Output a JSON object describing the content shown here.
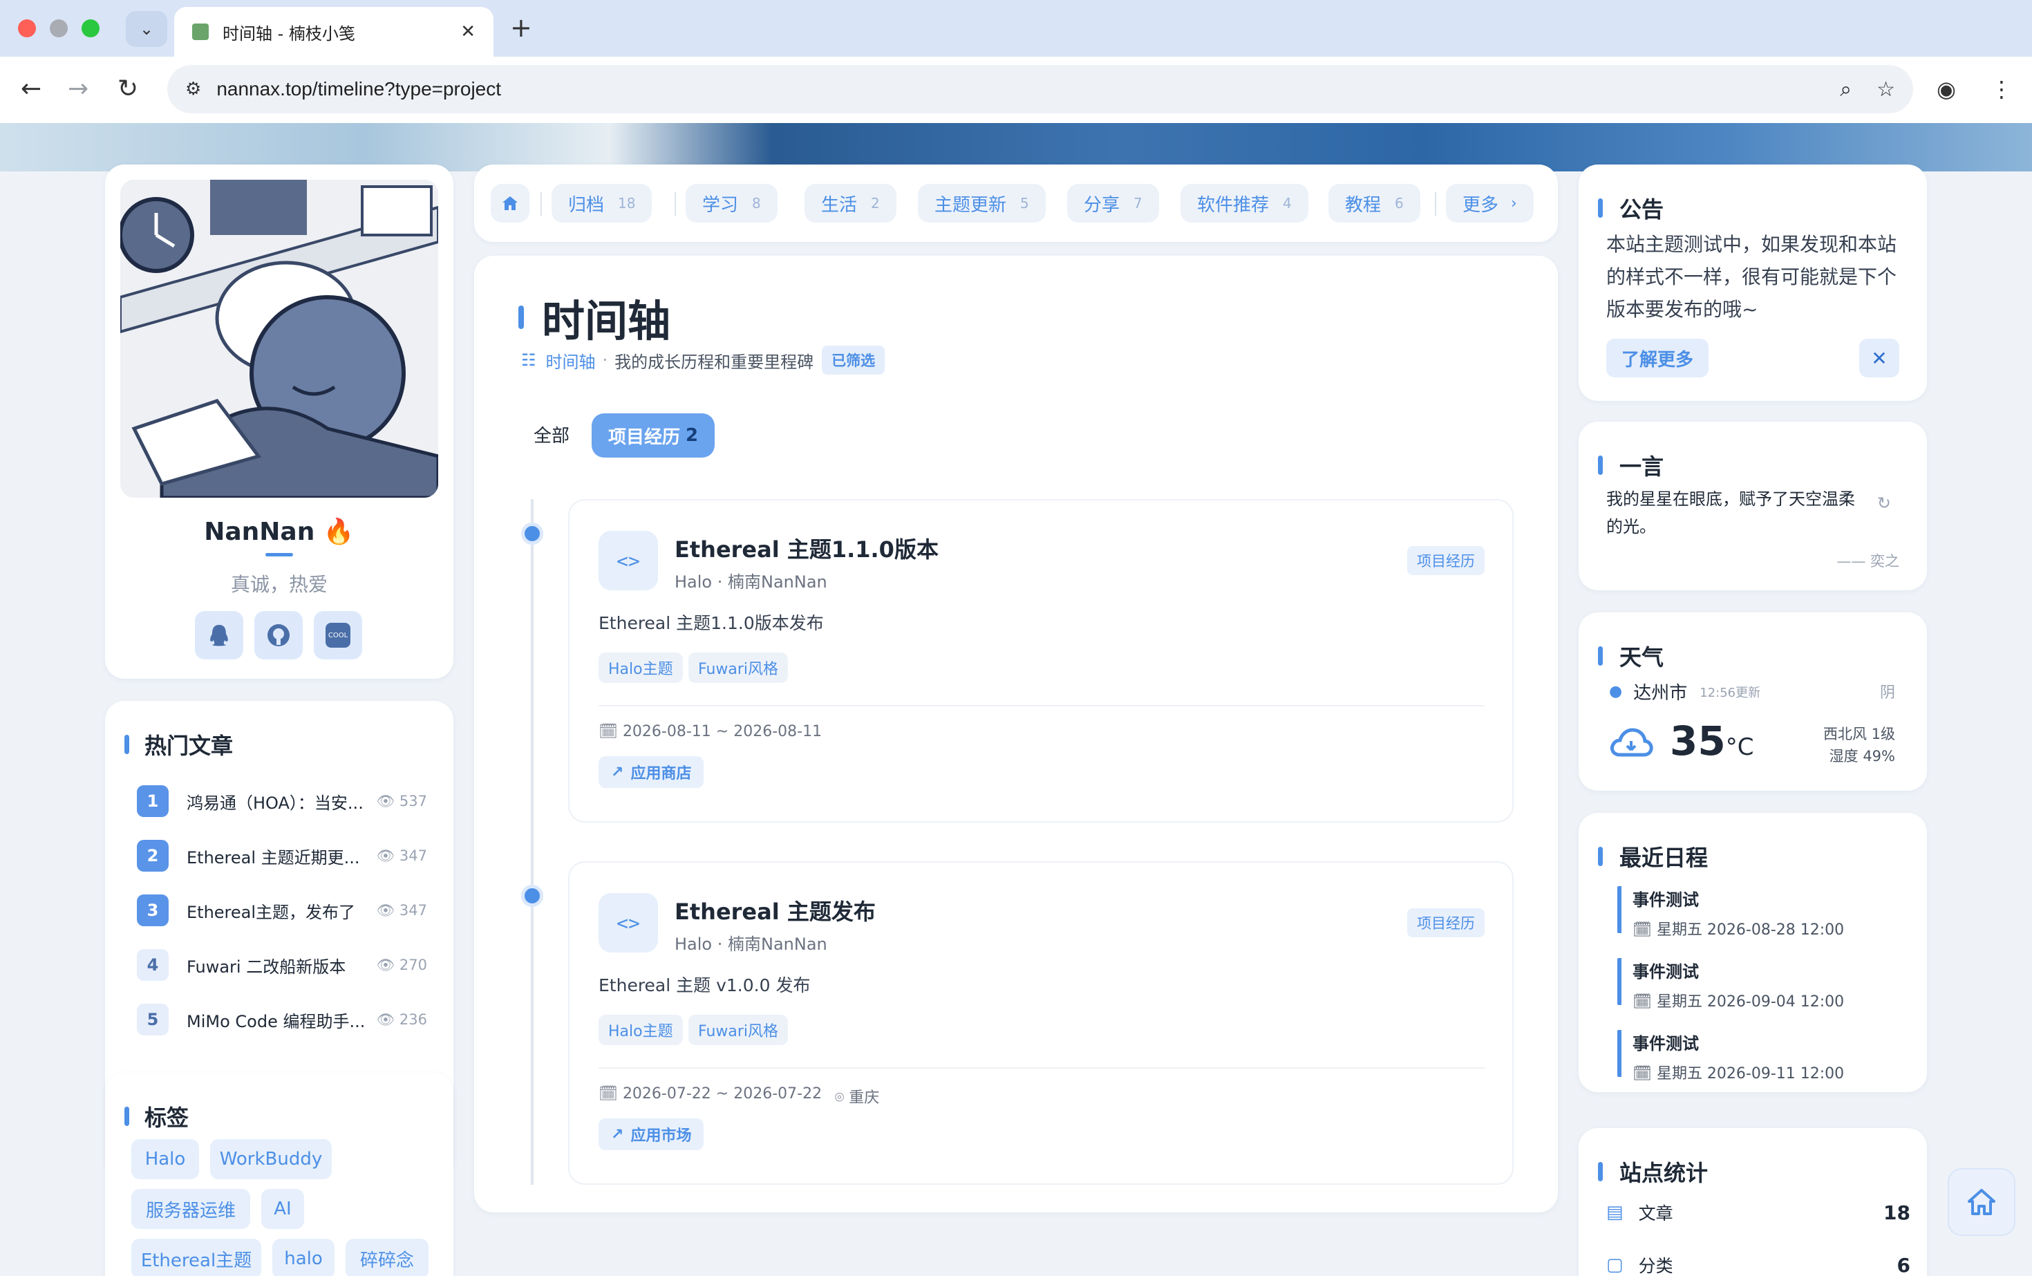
{
  "browser": {
    "tab_title": "时间轴 - 楠枝小笺",
    "url": "nannax.top/timeline?type=project",
    "tab_dropdown_icon": "chevron-down-icon",
    "new_tab_icon": "plus-icon"
  },
  "profile": {
    "name": "NanNan",
    "motto": "真诚，热爱",
    "social": [
      "qq-icon",
      "github-icon",
      "coolapk-icon"
    ],
    "social_cool_label": "COOL"
  },
  "hot": {
    "title": "热门文章",
    "items": [
      {
        "rank": "1",
        "title": "鸿易通（HOA）：当安...",
        "views": "537"
      },
      {
        "rank": "2",
        "title": "Ethereal 主题近期更...",
        "views": "347"
      },
      {
        "rank": "3",
        "title": "Ethereal主题，发布了",
        "views": "347"
      },
      {
        "rank": "4",
        "title": "Fuwari 二改船新版本",
        "views": "270"
      },
      {
        "rank": "5",
        "title": "MiMo Code 编程助手...",
        "views": "236"
      }
    ]
  },
  "tags": {
    "title": "标签",
    "items": [
      "Halo",
      "WorkBuddy",
      "服务器运维",
      "AI",
      "Ethereal主题",
      "halo",
      "碎碎念"
    ]
  },
  "nav": {
    "items": [
      {
        "label": "归档",
        "count": "18"
      },
      {
        "label": "学习",
        "count": "8"
      },
      {
        "label": "生活",
        "count": "2"
      },
      {
        "label": "主题更新",
        "count": "5"
      },
      {
        "label": "分享",
        "count": "7"
      },
      {
        "label": "软件推荐",
        "count": "4"
      },
      {
        "label": "教程",
        "count": "6"
      }
    ],
    "more": "更多",
    "more_icon": "chevron-right-icon",
    "home_icon": "home-icon"
  },
  "timeline": {
    "title": "时间轴",
    "crumb_link": "时间轴",
    "crumb_sep": "·",
    "crumb_desc": "我的成长历程和重要里程碑",
    "filtered_badge": "已筛选",
    "filter_all": "全部",
    "filter_active": "项目经历",
    "filter_active_count": "2",
    "entries": [
      {
        "title": "Ethereal 主题1.1.0版本",
        "subtitle": "Halo · 楠南NanNan",
        "category": "项目经历",
        "desc": "Ethereal 主题1.1.0版本发布",
        "tags": [
          "Halo主题",
          "Fuwari风格"
        ],
        "date": "2026-08-11 ~ 2026-08-11",
        "location": "",
        "link": "应用商店"
      },
      {
        "title": "Ethereal 主题发布",
        "subtitle": "Halo · 楠南NanNan",
        "category": "项目经历",
        "desc": "Ethereal 主题 v1.0.0 发布",
        "tags": [
          "Halo主题",
          "Fuwari风格"
        ],
        "date": "2026-07-22 ~ 2026-07-22",
        "location": "重庆",
        "link": "应用市场"
      }
    ]
  },
  "notice": {
    "title": "公告",
    "text": "本站主题测试中，如果发现和本站的样式不一样，很有可能就是下个版本要发布的哦~",
    "button": "了解更多",
    "close": "✕"
  },
  "quote": {
    "title": "一言",
    "text": "我的星星在眼底，赋予了天空温柔的光。",
    "author": "—— 奕之"
  },
  "weather": {
    "title": "天气",
    "city": "达州市",
    "updated": "12:56更新",
    "condition": "阴",
    "temp": "35",
    "unit": "°C",
    "wind": "西北风 1级",
    "humidity": "湿度 49%"
  },
  "schedule": {
    "title": "最近日程",
    "events": [
      {
        "name": "事件测试",
        "time": "星期五 2026-08-28 12:00"
      },
      {
        "name": "事件测试",
        "time": "星期五 2026-09-04 12:00"
      },
      {
        "name": "事件测试",
        "time": "星期五 2026-09-11 12:00"
      }
    ]
  },
  "stats": {
    "title": "站点统计",
    "rows": [
      {
        "label": "文章",
        "value": "18"
      },
      {
        "label": "分类",
        "value": "6"
      }
    ]
  },
  "colors": {
    "accent": "#4c8fe6",
    "chip_bg": "#e6effb",
    "page_bg": "#eff3f8"
  }
}
